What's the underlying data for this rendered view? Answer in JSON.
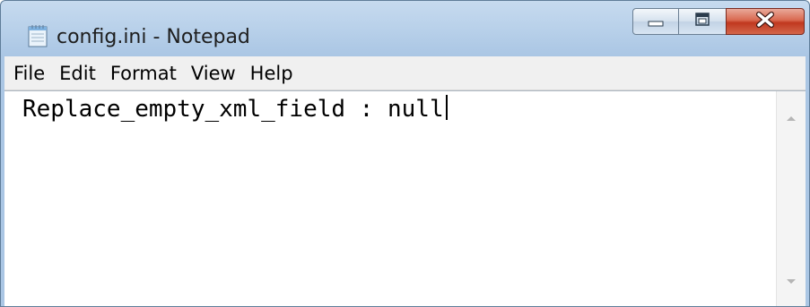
{
  "window": {
    "title": "config.ini - Notepad"
  },
  "menu": [
    {
      "label": "File"
    },
    {
      "label": "Edit"
    },
    {
      "label": "Format"
    },
    {
      "label": "View"
    },
    {
      "label": "Help"
    }
  ],
  "editor": {
    "content": "Replace_empty_xml_field : null"
  },
  "icons": {
    "app": "notepad-icon",
    "minimize": "minimize-icon",
    "maximize": "maximize-icon",
    "close": "close-icon",
    "scroll_up": "scroll-up-arrow-icon",
    "scroll_down": "scroll-down-arrow-icon"
  },
  "colors": {
    "titlebar": "#b9d1ea",
    "close_button": "#c0381f",
    "menubar": "#f0f0f0",
    "editor_bg": "#ffffff"
  }
}
